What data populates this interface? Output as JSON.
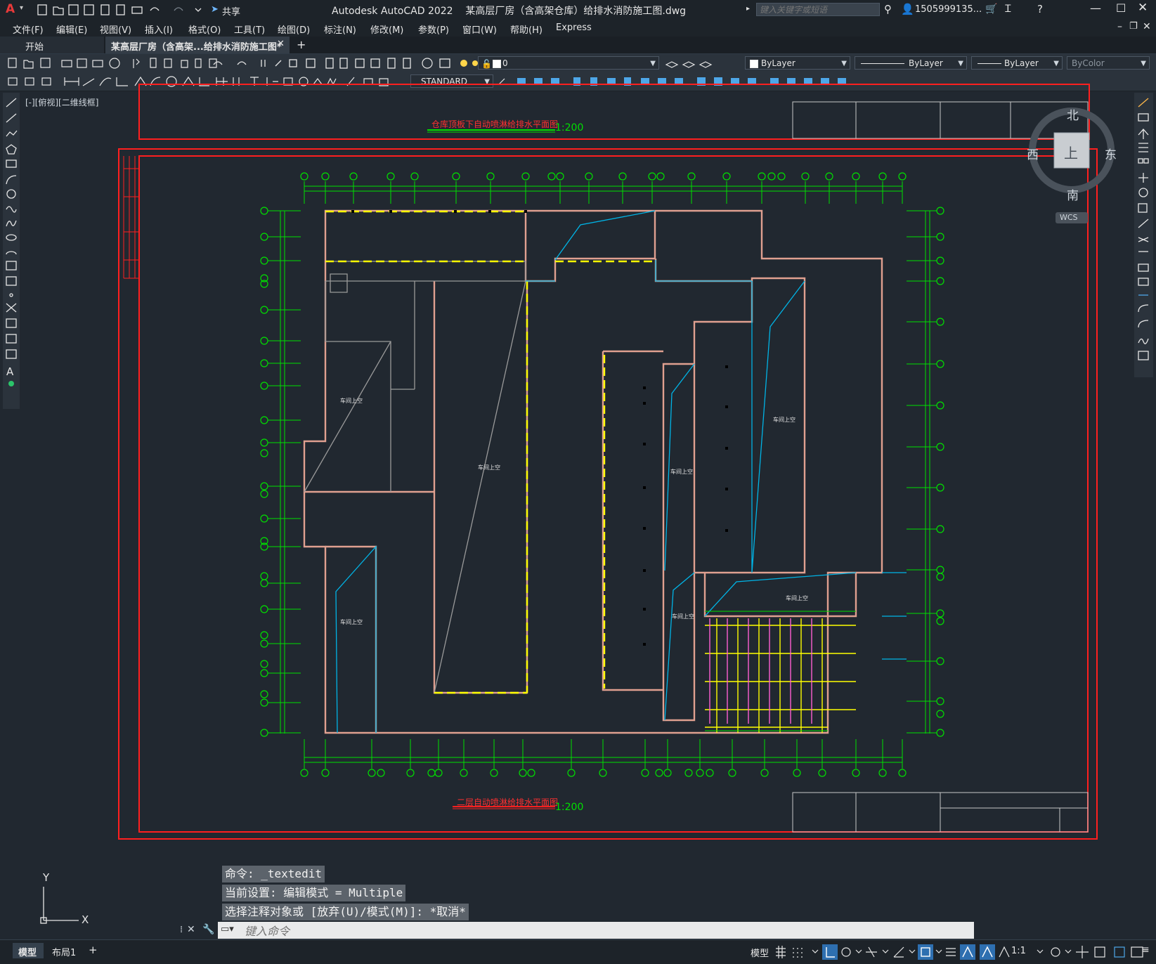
{
  "app": {
    "logo": "A",
    "title": "Autodesk AutoCAD 2022    某高层厂房（含高架仓库）给排水消防施工图.dwg",
    "share_label": "共享",
    "search_placeholder": "键入关键字或短语",
    "user": "1505999135...",
    "window_controls": [
      "minimize-icon",
      "maximize-icon",
      "close-icon"
    ]
  },
  "menu": [
    "文件(F)",
    "编辑(E)",
    "视图(V)",
    "插入(I)",
    "格式(O)",
    "工具(T)",
    "绘图(D)",
    "标注(N)",
    "修改(M)",
    "参数(P)",
    "窗口(W)",
    "帮助(H)",
    "Express"
  ],
  "tabs": {
    "start": "开始",
    "active": "某高层厂房（含高架...给排水消防施工图*",
    "add": "+"
  },
  "toolbar": {
    "layer_value": "0",
    "color_value": "ByLayer",
    "linetype_value": "ByLayer",
    "lineweight_value": "ByLayer",
    "plotstyle_value": "ByColor",
    "textstyle_value": "STANDARD"
  },
  "viewport": {
    "label": "[-][俯视][二维线框]",
    "compass": {
      "north": "北",
      "south": "南",
      "east": "东",
      "west": "西",
      "top": "上"
    },
    "wcs": "WCS"
  },
  "drawing": {
    "plan1_title": "仓库顶板下自动喷淋给排水平面图",
    "plan1_scale": "1:200",
    "plan2_title": "二层自动喷淋给排水平面图",
    "plan2_scale": "1:200",
    "room_label": "车间上空"
  },
  "command": {
    "history": [
      "命令: _textedit",
      "当前设置: 编辑模式 = Multiple",
      "选择注释对象或 [放弃(U)/模式(M)]: *取消*"
    ],
    "placeholder": "键入命令"
  },
  "layout_tabs": [
    "模型",
    "布局1",
    "+"
  ],
  "status": {
    "model": "模型",
    "scale": "1:1"
  },
  "colors": {
    "red": "#ff1f1f",
    "green": "#00e000",
    "yellow": "#ffff00",
    "cyan": "#00b4e6",
    "pink": "#e0a090"
  }
}
